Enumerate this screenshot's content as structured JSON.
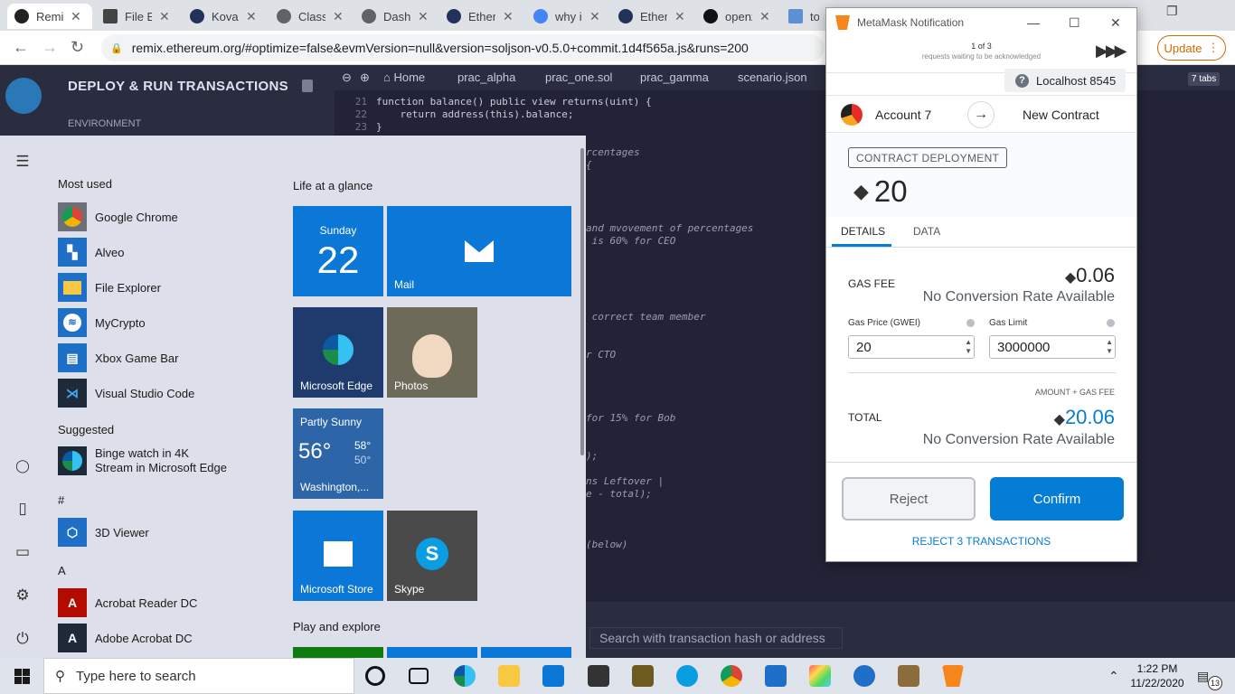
{
  "browser": {
    "tabs": [
      {
        "label": "Remix",
        "icon": "remix-icon",
        "active": true
      },
      {
        "label": "File Explorer",
        "icon": "file-icon"
      },
      {
        "label": "Kovan",
        "icon": "etherscan-icon"
      },
      {
        "label": "Class",
        "icon": "globe-icon"
      },
      {
        "label": "Dashboard",
        "icon": "globe-icon"
      },
      {
        "label": "Ethereum",
        "icon": "etherscan-icon"
      },
      {
        "label": "why is",
        "icon": "google-icon"
      },
      {
        "label": "Ethereum",
        "icon": "etherscan-icon"
      },
      {
        "label": "openzeppelin",
        "icon": "github-icon"
      },
      {
        "label": "tok",
        "icon": "eth-icon"
      }
    ],
    "url": "remix.ethereum.org/#optimize=false&evmVersion=null&version=soljson-v0.5.0+commit.1d4f565a.js&runs=200",
    "update_label": "Update"
  },
  "remix": {
    "panel_title": "DEPLOY & RUN TRANSACTIONS",
    "environment_label": "ENVIRONMENT",
    "editor_tabs": [
      "Home",
      "prac_alpha",
      "prac_one.sol",
      "prac_gamma",
      "scenario.json"
    ],
    "tabs_count": "7 tabs",
    "code_lines": [
      {
        "num": "21",
        "text": "function balance() public view returns(uint) {"
      },
      {
        "num": "22",
        "text": "    return address(this).balance;"
      },
      {
        "num": "23",
        "text": "}"
      }
    ],
    "fragments": [
      "rcentages",
      "{",
      "and mvovement of percentages",
      " is 60% for CEO",
      " correct team member",
      "r CTO",
      "for 15% for Bob",
      ");",
      "ns Leftover |",
      "e - total);",
      "(below)"
    ],
    "search_placeholder": "Search with transaction hash or address"
  },
  "start_menu": {
    "most_used_heading": "Most used",
    "most_used": [
      {
        "label": "Google Chrome",
        "icon": "chrome-icon",
        "color": "#6b6f78"
      },
      {
        "label": "Alveo",
        "icon": "alveo-icon",
        "color": "#1e6fc8"
      },
      {
        "label": "File Explorer",
        "icon": "folder-icon",
        "color": "#1e6fc8"
      },
      {
        "label": "MyCrypto",
        "icon": "mycrypto-icon",
        "color": "#1e6fc8"
      },
      {
        "label": "Xbox Game Bar",
        "icon": "xbox-icon",
        "color": "#1e6fc8"
      },
      {
        "label": "Visual Studio Code",
        "icon": "vscode-icon",
        "color": "#1e2a3a"
      }
    ],
    "suggested_heading": "Suggested",
    "suggested": {
      "line1": "Binge watch in 4K",
      "line2": "Stream in Microsoft Edge"
    },
    "hash_letter": "#",
    "viewer_label": "3D Viewer",
    "a_letter": "A",
    "a_apps": [
      {
        "label": "Acrobat Reader DC",
        "icon": "acrobat-icon",
        "color": "#b30b00"
      },
      {
        "label": "Adobe Acrobat DC",
        "icon": "adobe-icon",
        "color": "#1e2a3a"
      }
    ],
    "life_heading": "Life at a glance",
    "calendar": {
      "day": "Sunday",
      "date": "22"
    },
    "mail_label": "Mail",
    "edge_label": "Microsoft Edge",
    "photos_label": "Photos",
    "weather": {
      "condition": "Partly Sunny",
      "temp": "56°",
      "high": "58°",
      "low": "50°",
      "city": "Washington,..."
    },
    "store_label": "Microsoft Store",
    "skype_label": "Skype",
    "play_heading": "Play and explore"
  },
  "metamask": {
    "window_title": "MetaMask Notification",
    "queue_count": "1 of 3",
    "queue_sub": "requests waiting to be acknowledged",
    "network": "Localhost 8545",
    "account": "Account 7",
    "target": "New Contract",
    "tx_type": "CONTRACT DEPLOYMENT",
    "amount": "20",
    "tabs": [
      "DETAILS",
      "DATA"
    ],
    "gas_fee_label": "GAS FEE",
    "gas_fee_value": "0.06",
    "no_conversion": "No Conversion Rate Available",
    "gas_price_label": "Gas Price (GWEI)",
    "gas_price_value": "20",
    "gas_limit_label": "Gas Limit",
    "gas_limit_value": "3000000",
    "amount_plus_gas": "AMOUNT + GAS FEE",
    "total_label": "TOTAL",
    "total_value": "20.06",
    "reject_label": "Reject",
    "confirm_label": "Confirm",
    "reject_all_label": "REJECT 3 TRANSACTIONS",
    "accent_color": "#037dd6"
  },
  "taskbar": {
    "search_placeholder": "Type here to search",
    "time": "1:22 PM",
    "date": "11/22/2020",
    "notification_count": "13"
  }
}
